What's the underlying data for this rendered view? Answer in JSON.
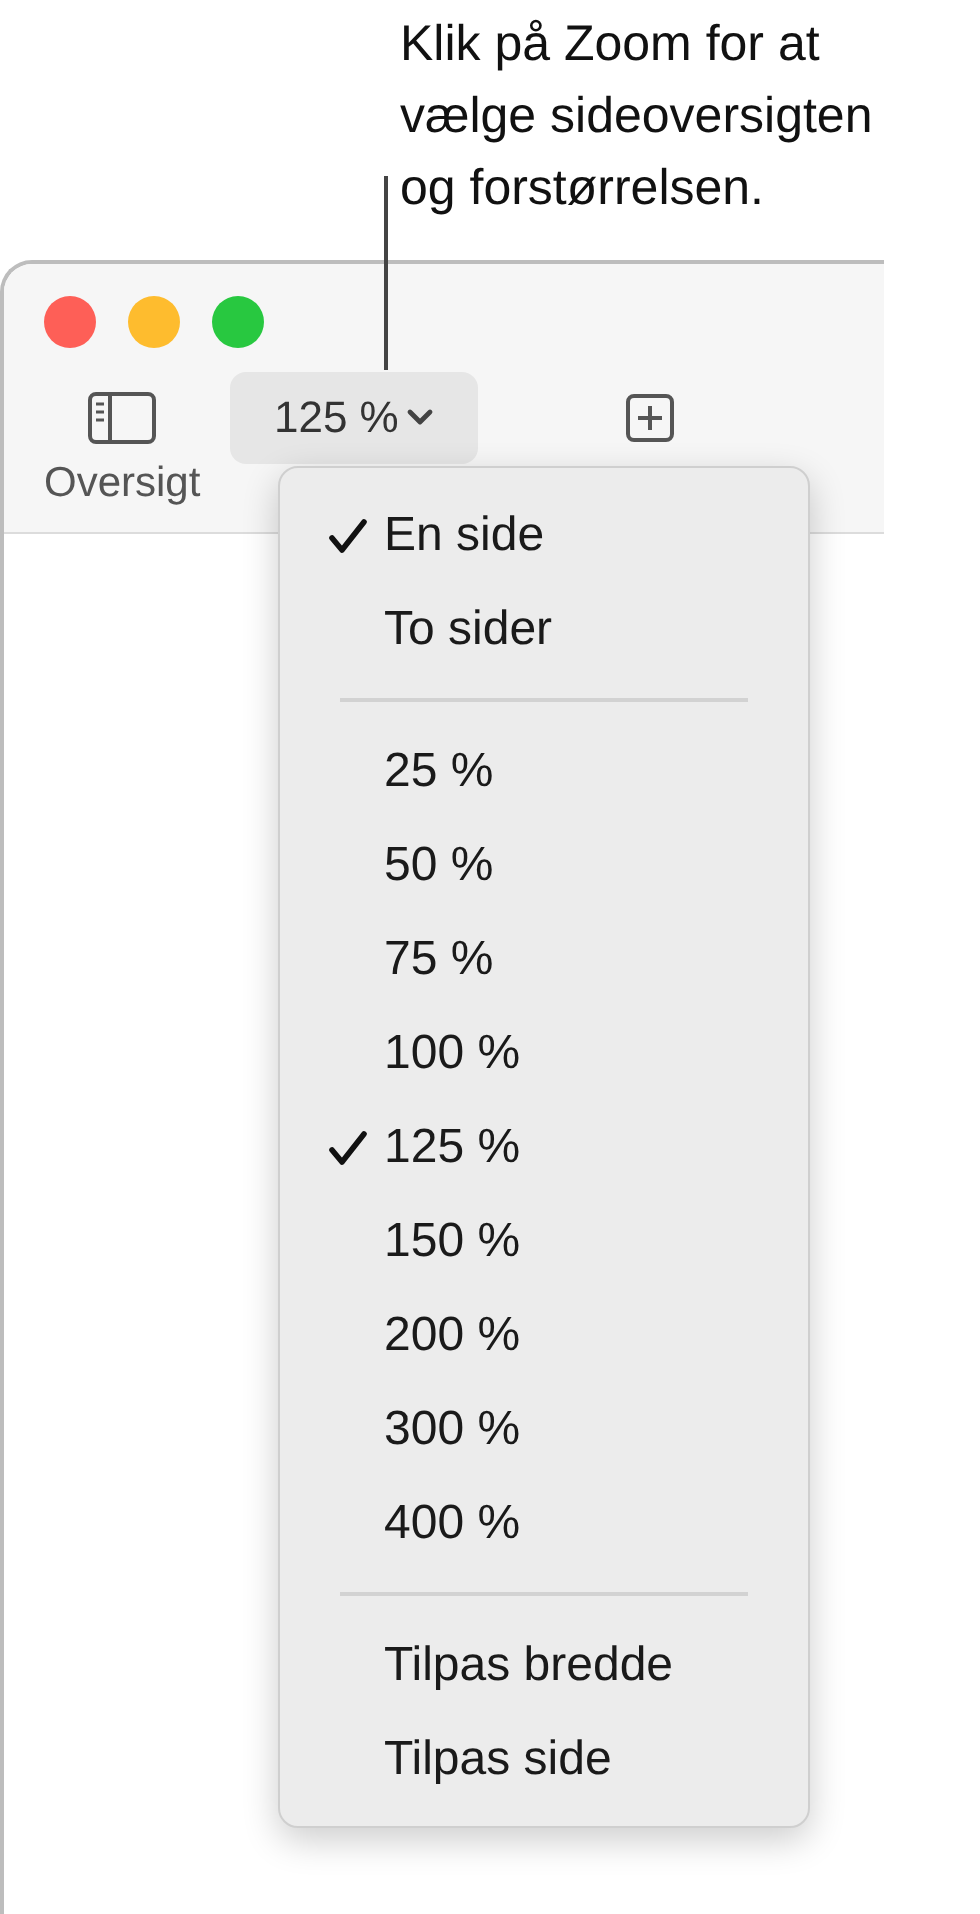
{
  "callout": {
    "text": "Klik på Zoom for at\nvælge sideoversigten\nog forstørrelsen."
  },
  "toolbar": {
    "sidebar_button": {
      "label": "Oversigt"
    },
    "zoom_button": {
      "label": "125 %",
      "expanded": true
    }
  },
  "zoom_menu": {
    "sections": [
      [
        {
          "label": "En side",
          "selected": true
        },
        {
          "label": "To sider",
          "selected": false
        }
      ],
      [
        {
          "label": "25 %",
          "selected": false
        },
        {
          "label": "50 %",
          "selected": false
        },
        {
          "label": "75 %",
          "selected": false
        },
        {
          "label": "100 %",
          "selected": false
        },
        {
          "label": "125 %",
          "selected": true
        },
        {
          "label": "150 %",
          "selected": false
        },
        {
          "label": "200 %",
          "selected": false
        },
        {
          "label": "300 %",
          "selected": false
        },
        {
          "label": "400 %",
          "selected": false
        }
      ],
      [
        {
          "label": "Tilpas bredde",
          "selected": false
        },
        {
          "label": "Tilpas side",
          "selected": false
        }
      ]
    ]
  }
}
